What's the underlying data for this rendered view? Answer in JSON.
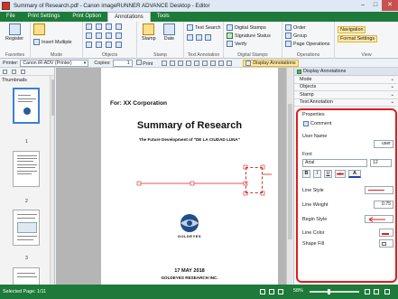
{
  "window": {
    "title": "Summary of Research.pdf - Canon imageRUNNER ADVANCE Desktop - Editor",
    "minimize": "–",
    "maximize": "□",
    "close": "✕"
  },
  "ribbon_tabs": [
    "File",
    "Print Settings",
    "Print Option",
    "Annotations",
    "Tools"
  ],
  "active_tab": "Annotations",
  "ribbon": {
    "favorites": {
      "label": "Favorites",
      "register": "Register"
    },
    "mode": {
      "label": "Mode",
      "insert_multiple": "Insert Multiple"
    },
    "objects": {
      "label": "Objects"
    },
    "stamp": {
      "label": "Stamp",
      "stamp_btn": "Stamp",
      "date_btn": "Date"
    },
    "text_annotation": {
      "label": "Text Annotation",
      "text_search": "Text Search"
    },
    "digital_stamps": {
      "label": "Digital Stamps",
      "digital_stamps": "Digital Stamps",
      "signature_status": "Signature Status",
      "verify": "Verify"
    },
    "operations": {
      "label": "Operations",
      "order": "Order",
      "group": "Group",
      "page_operations": "Page Operations"
    },
    "view": {
      "label": "View",
      "navigation": "Navigation",
      "format_settings": "Format Settings"
    }
  },
  "toolbar": {
    "printer_label": "Printer:",
    "printer_value": "Canon iR-ADV (Printer)",
    "copies_label": "Copies:",
    "copies_value": "1",
    "print_btn": "Print",
    "display_annotations": "Display Annotations"
  },
  "thumbnails": {
    "title": "Thumbnails",
    "pages": [
      "1",
      "2",
      "3"
    ]
  },
  "document": {
    "for_corp": "For: XX Corporation",
    "title": "Summary of Research",
    "subtitle": "The Future Development of \"DE LA CIUDAD LUNA\"",
    "logo_text": "GOLDEYES",
    "date": "17 MAY 2018",
    "company": "GOLDEYES RESEARCH INC."
  },
  "panel": {
    "sections": [
      "Mode",
      "Objects",
      "Stamp",
      "Text Annotation"
    ],
    "properties_title": "Properties",
    "comment": "Comment",
    "user_name_label": "User Name",
    "user_name_value": "user",
    "font_label": "Font",
    "font_value": "Arial",
    "font_size": "12",
    "bold": "B",
    "italic": "I",
    "underline": "U",
    "strike": "abc",
    "font_color_label": "A",
    "line_style_label": "Line Style",
    "line_weight_label": "Line Weight",
    "line_weight_value": "0.75",
    "begin_style_label": "Begin Style",
    "line_color_label": "Line Color",
    "shape_fill_label": "Shape Fill",
    "line_color": "#e21b1b"
  },
  "status": {
    "selected_page": "Selected Page: 1/11",
    "zoom": "58%",
    "zoom_level": 0.38
  }
}
